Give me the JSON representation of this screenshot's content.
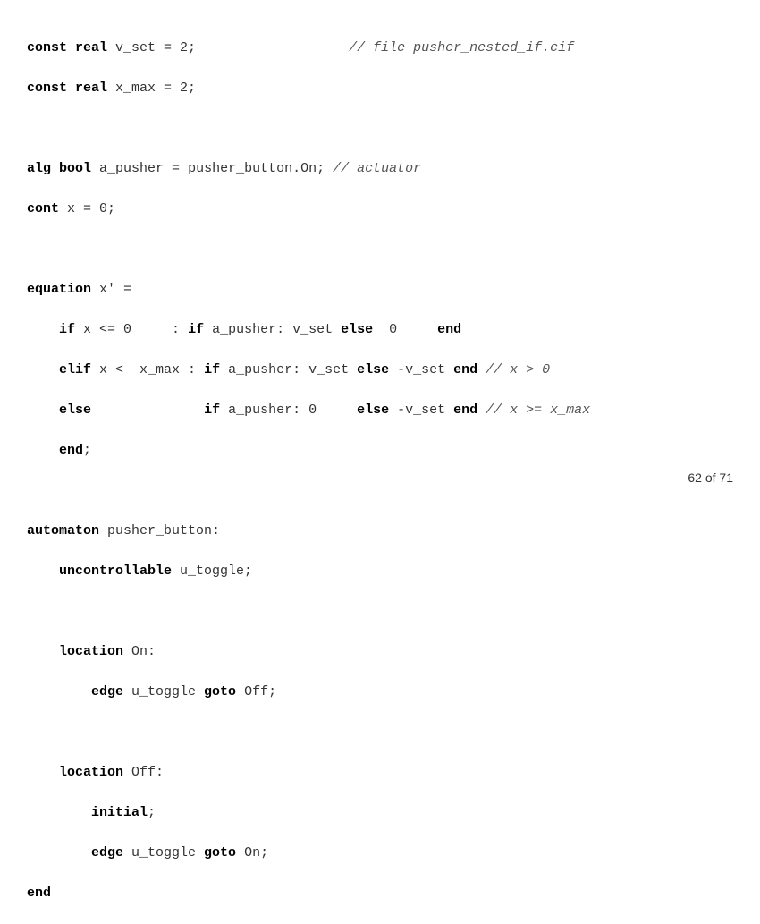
{
  "code": {
    "l1": {
      "k1": "const",
      "k2": "real",
      "t1": " v_set = 2;                   ",
      "c1": "// file pusher_nested_if.cif"
    },
    "l2": {
      "k1": "const",
      "k2": "real",
      "t1": " x_max = 2;"
    },
    "l4": {
      "k1": "alg",
      "k2": "bool",
      "t1": " a_pusher = pusher_button.On; ",
      "c1": "// actuator"
    },
    "l5": {
      "k1": "cont",
      "t1": " x = 0;"
    },
    "l7": {
      "k1": "equation",
      "t1": " x' ="
    },
    "l8": {
      "i1": "    ",
      "k1": "if",
      "t1": " x <= 0     : ",
      "k2": "if",
      "t2": " a_pusher: v_set ",
      "k3": "else",
      "t3": "  0     ",
      "k4": "end"
    },
    "l9": {
      "i1": "    ",
      "k1": "elif",
      "t1": " x <  x_max : ",
      "k2": "if",
      "t2": " a_pusher: v_set ",
      "k3": "else",
      "t3": " -v_set ",
      "k4": "end",
      "c1": " // x > 0"
    },
    "l10": {
      "i1": "    ",
      "k1": "else",
      "t1": "              ",
      "k2": "if",
      "t2": " a_pusher: 0     ",
      "k3": "else",
      "t3": " -v_set ",
      "k4": "end",
      "c1": " // x >= x_max"
    },
    "l11": {
      "i1": "    ",
      "k1": "end",
      "t1": ";"
    },
    "l13": {
      "k1": "automaton",
      "t1": " pusher_button:"
    },
    "l14": {
      "i1": "    ",
      "k1": "uncontrollable",
      "t1": " u_toggle;"
    },
    "l16": {
      "i1": "    ",
      "k1": "location",
      "t1": " On:"
    },
    "l17": {
      "i1": "        ",
      "k1": "edge",
      "t1": " u_toggle ",
      "k2": "goto",
      "t2": " Off;"
    },
    "l19": {
      "i1": "    ",
      "k1": "location",
      "t1": " Off:"
    },
    "l20": {
      "i1": "        ",
      "k1": "initial",
      "t1": ";"
    },
    "l21": {
      "i1": "        ",
      "k1": "edge",
      "t1": " u_toggle ",
      "k2": "goto",
      "t2": " On;"
    },
    "l22": {
      "k1": "end"
    }
  },
  "pagination": {
    "current": "62",
    "sep": " of ",
    "total": "71"
  }
}
